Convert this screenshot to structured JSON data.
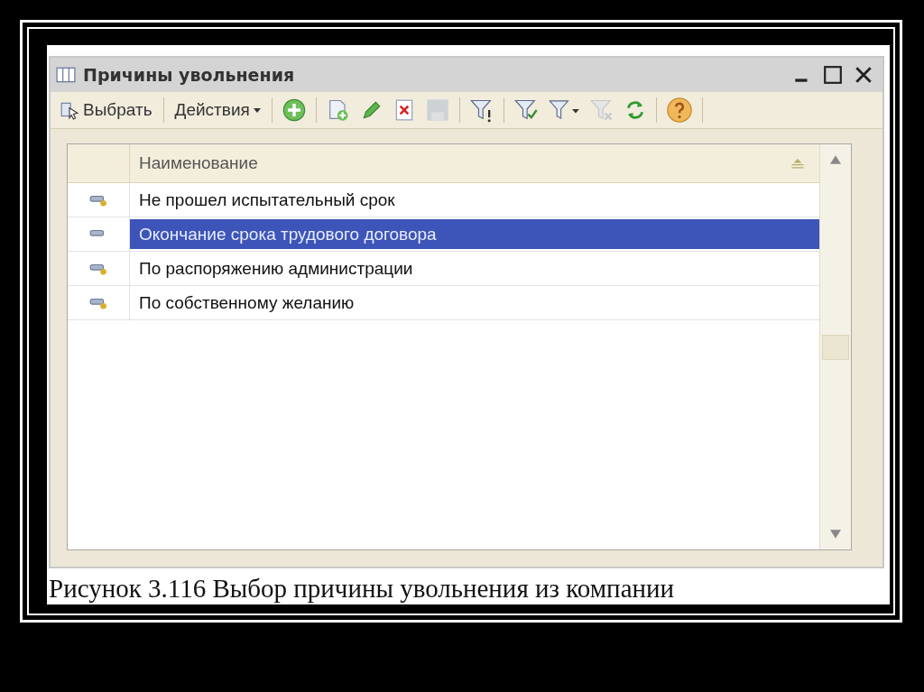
{
  "window": {
    "title": "Причины увольнения"
  },
  "toolbar": {
    "buttons": [
      {
        "label": "Выбрать",
        "kind": "select",
        "dropdown": false
      },
      {
        "label": "Действия",
        "kind": "actions",
        "dropdown": true
      }
    ],
    "icons": [
      {
        "kind": "add",
        "disabled": false
      },
      {
        "kind": "copy",
        "disabled": false
      },
      {
        "kind": "edit",
        "disabled": false
      },
      {
        "kind": "delete",
        "disabled": false
      },
      {
        "kind": "save",
        "disabled": true
      },
      {
        "kind": "filter",
        "disabled": false
      },
      {
        "kind": "filter-check",
        "disabled": false
      },
      {
        "kind": "filter-menu",
        "disabled": false
      },
      {
        "kind": "filter-clear",
        "disabled": true
      },
      {
        "kind": "refresh",
        "disabled": false
      },
      {
        "kind": "help",
        "disabled": false
      }
    ]
  },
  "table": {
    "columns": [
      "Наименование"
    ],
    "rows": [
      {
        "name": "Не прошел испытательный срок",
        "selected": false,
        "marked": true
      },
      {
        "name": "Окончание срока трудового договора",
        "selected": true,
        "marked": false
      },
      {
        "name": "По распоряжению администрации",
        "selected": false,
        "marked": true
      },
      {
        "name": "По собственному желанию",
        "selected": false,
        "marked": true
      }
    ]
  },
  "caption": "Рисунок 3.116 Выбор причины увольнения из компании"
}
